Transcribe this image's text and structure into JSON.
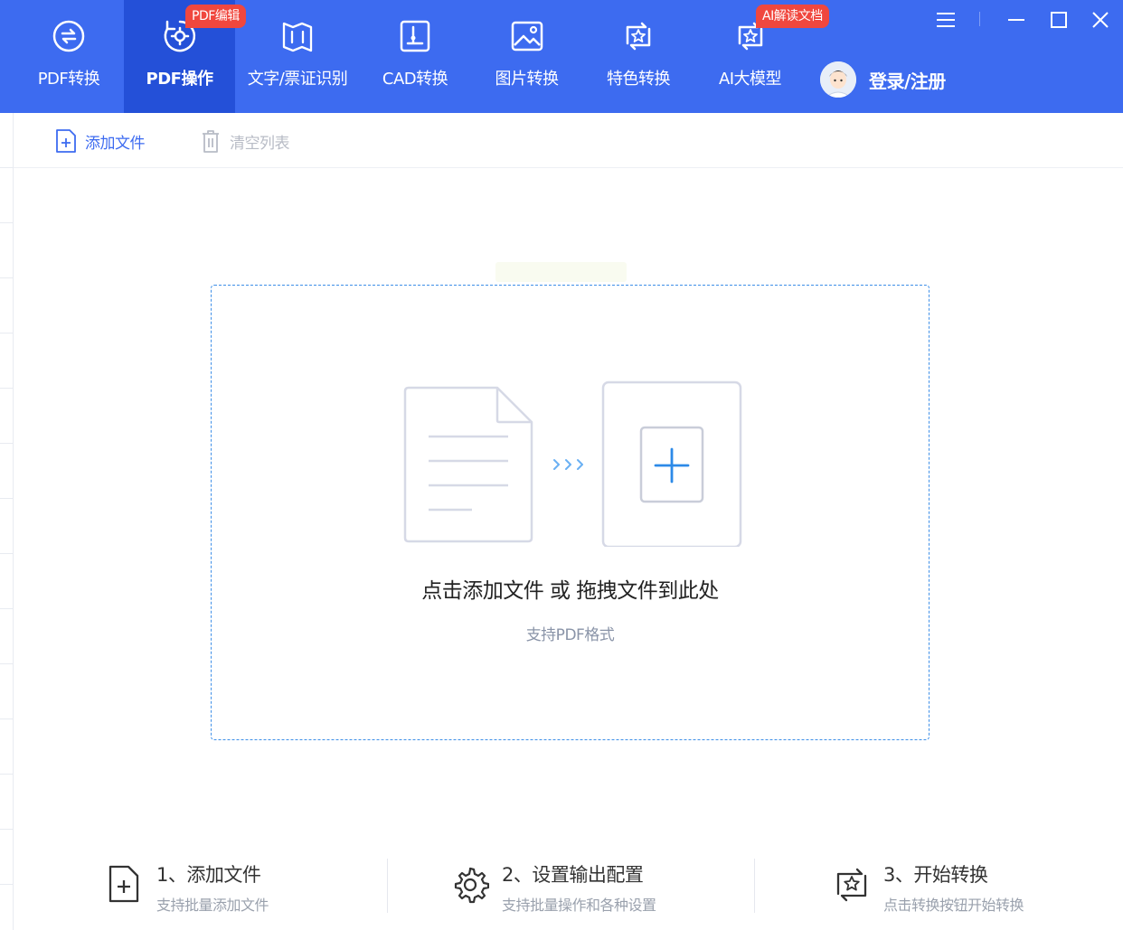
{
  "nav": {
    "items": [
      {
        "label": "PDF转换",
        "icon": "pdf-convert-icon"
      },
      {
        "label": "PDF操作",
        "icon": "pdf-operate-icon",
        "badge": "PDF编辑",
        "active": true
      },
      {
        "label": "文字/票证识别",
        "icon": "ocr-icon"
      },
      {
        "label": "CAD转换",
        "icon": "cad-icon"
      },
      {
        "label": "图片转换",
        "icon": "image-icon"
      },
      {
        "label": "特色转换",
        "icon": "special-icon"
      },
      {
        "label": "AI大模型",
        "icon": "ai-model-icon",
        "badge": "AI解读文档"
      }
    ],
    "login_label": "登录/注册"
  },
  "toolbar": {
    "add_label": "添加文件",
    "clear_label": "清空列表"
  },
  "dropzone": {
    "main_text": "点击添加文件 或 拖拽文件到此处",
    "sub_text": "支持PDF格式"
  },
  "steps": [
    {
      "title": "1、添加文件",
      "desc": "支持批量添加文件",
      "icon": "file-add-icon"
    },
    {
      "title": "2、设置输出配置",
      "desc": "支持批量操作和各种设置",
      "icon": "settings-gear-icon"
    },
    {
      "title": "3、开始转换",
      "desc": "点击转换按钮开始转换",
      "icon": "convert-icon"
    }
  ],
  "colors": {
    "topbar": "#3d6bf0",
    "topbar_active": "#2450d8",
    "badge": "#f0473e",
    "accent": "#3e8fe8"
  }
}
